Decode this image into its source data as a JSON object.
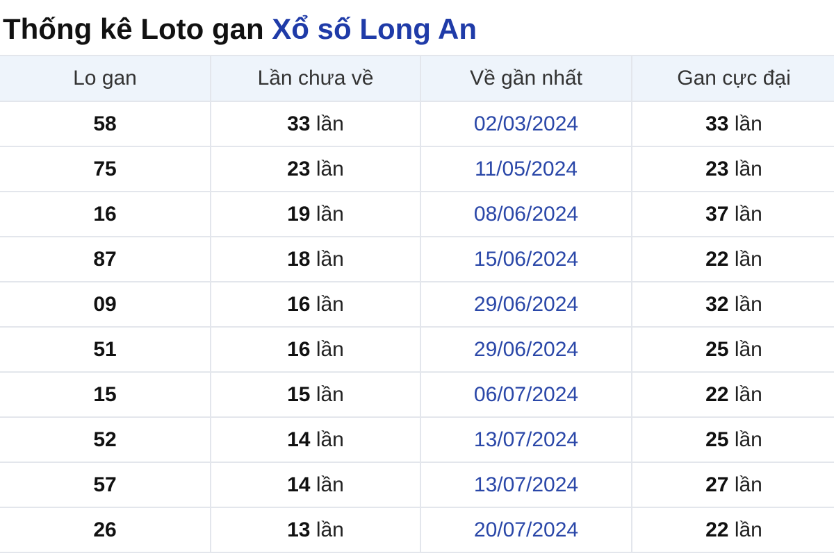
{
  "title": {
    "main": "Thống kê Loto gan ",
    "accent": "Xổ số Long An"
  },
  "table": {
    "headers": [
      "Lo gan",
      "Lần chưa về",
      "Về gần nhất",
      "Gan cực đại"
    ],
    "rows": [
      {
        "lo": "58",
        "chua_ve": "33",
        "chua_ve_unit": " lần",
        "ngay": "02/03/2024",
        "cuc_dai": "33",
        "cuc_dai_unit": " lần"
      },
      {
        "lo": "75",
        "chua_ve": "23",
        "chua_ve_unit": " lần",
        "ngay": "11/05/2024",
        "cuc_dai": "23",
        "cuc_dai_unit": " lần"
      },
      {
        "lo": "16",
        "chua_ve": "19",
        "chua_ve_unit": " lần",
        "ngay": "08/06/2024",
        "cuc_dai": "37",
        "cuc_dai_unit": " lần"
      },
      {
        "lo": "87",
        "chua_ve": "18",
        "chua_ve_unit": " lần",
        "ngay": "15/06/2024",
        "cuc_dai": "22",
        "cuc_dai_unit": " lần"
      },
      {
        "lo": "09",
        "chua_ve": "16",
        "chua_ve_unit": " lần",
        "ngay": "29/06/2024",
        "cuc_dai": "32",
        "cuc_dai_unit": " lần"
      },
      {
        "lo": "51",
        "chua_ve": "16",
        "chua_ve_unit": " lần",
        "ngay": "29/06/2024",
        "cuc_dai": "25",
        "cuc_dai_unit": " lần"
      },
      {
        "lo": "15",
        "chua_ve": "15",
        "chua_ve_unit": " lần",
        "ngay": "06/07/2024",
        "cuc_dai": "22",
        "cuc_dai_unit": " lần"
      },
      {
        "lo": "52",
        "chua_ve": "14",
        "chua_ve_unit": " lần",
        "ngay": "13/07/2024",
        "cuc_dai": "25",
        "cuc_dai_unit": " lần"
      },
      {
        "lo": "57",
        "chua_ve": "14",
        "chua_ve_unit": " lần",
        "ngay": "13/07/2024",
        "cuc_dai": "27",
        "cuc_dai_unit": " lần"
      },
      {
        "lo": "26",
        "chua_ve": "13",
        "chua_ve_unit": " lần",
        "ngay": "20/07/2024",
        "cuc_dai": "22",
        "cuc_dai_unit": " lần"
      }
    ]
  },
  "colors": {
    "accent": "#1f3ba8",
    "date_link": "#2a47a8",
    "header_bg": "#eef4fb",
    "border": "#e3e6ec"
  }
}
